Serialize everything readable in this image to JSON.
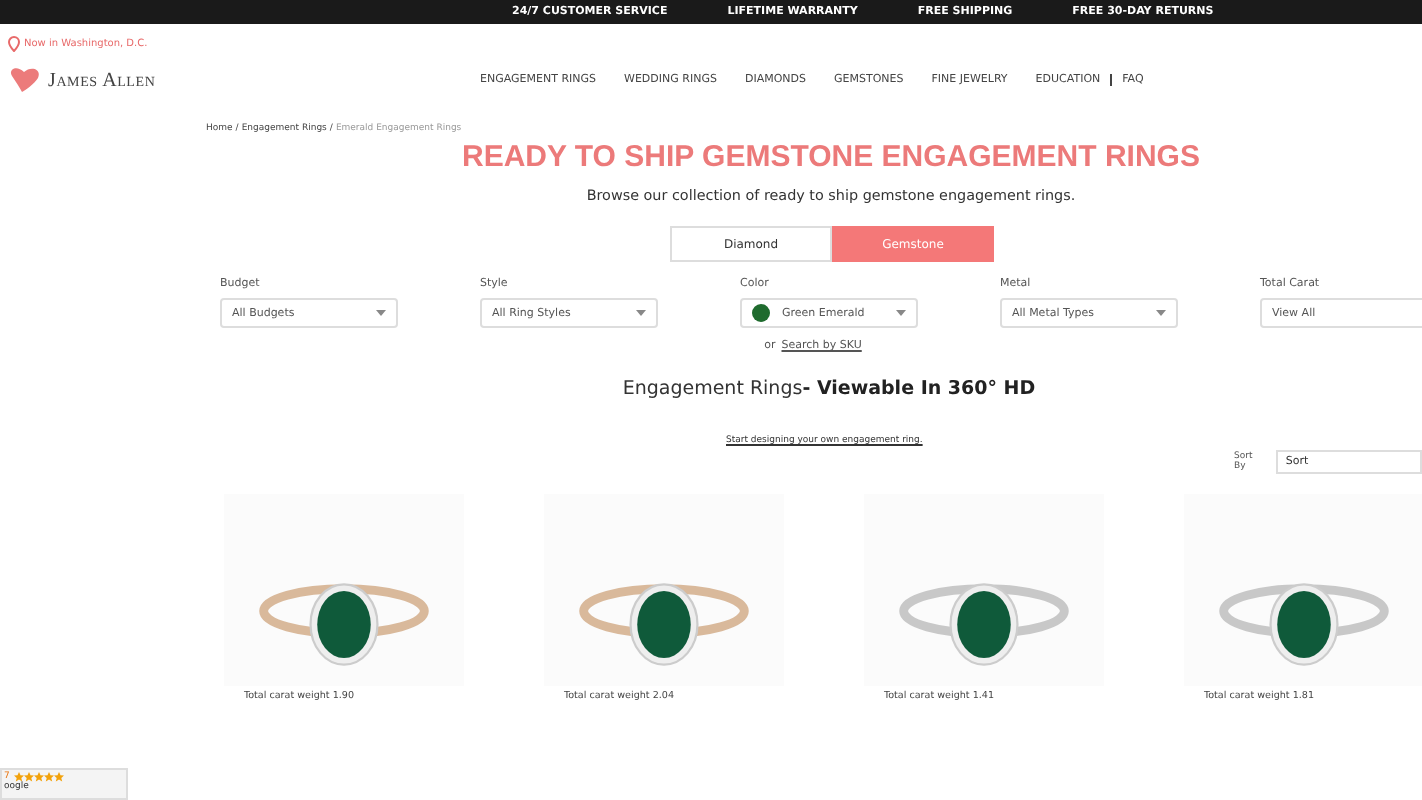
{
  "top_bar": {
    "items": [
      "24/7 CUSTOMER SERVICE",
      "LIFETIME WARRANTY",
      "FREE SHIPPING",
      "FREE 30-DAY RETURNS"
    ]
  },
  "location": "Now in Washington, D.C.",
  "logo": "James Allen",
  "nav": {
    "items": [
      "ENGAGEMENT RINGS",
      "WEDDING RINGS",
      "DIAMONDS",
      "GEMSTONES",
      "FINE JEWELRY",
      "EDUCATION",
      "FAQ"
    ]
  },
  "breadcrumb": [
    {
      "kind": "link",
      "label": "Home"
    },
    {
      "kind": "separator",
      "label": "/"
    },
    {
      "kind": "link",
      "label": "Engagement Rings"
    },
    {
      "kind": "separator",
      "label": "/"
    },
    {
      "kind": "current",
      "label": "Emerald Engagement Rings"
    }
  ],
  "title": "READY TO SHIP GEMSTONE ENGAGEMENT RINGS",
  "subtitle": "Browse our collection of ready to ship gemstone engagement rings.",
  "toggle": [
    {
      "label": "Diamond",
      "selected": false
    },
    {
      "label": "Gemstone",
      "selected": true
    }
  ],
  "filters": [
    {
      "label": "Budget",
      "value": "All Budgets"
    },
    {
      "label": "Style",
      "value": "All Ring Styles"
    },
    {
      "label": "Color",
      "value": "Green Emerald",
      "color": "#1f6b2e"
    },
    {
      "label": "Metal",
      "value": "All Metal Types"
    },
    {
      "label": "Total Carat",
      "value": "View All"
    }
  ],
  "sku": {
    "prefix": "or",
    "link": "Search by SKU"
  },
  "section_heading": "Engagement Rings**- Viewable In 360° HD**",
  "design_link": "Start designing your own engagement ring.",
  "sort": {
    "label": "Sort By",
    "value": "Sort"
  },
  "products": [
    {
      "caption": "Total carat weight 1.90",
      "kind": "rose"
    },
    {
      "caption": "Total carat weight 2.04",
      "kind": "rose"
    },
    {
      "caption": "Total carat weight 1.41",
      "kind": "white"
    },
    {
      "caption": "Total carat weight 1.81",
      "kind": "white"
    }
  ],
  "review_badge": {
    "rating": "7",
    "stars": 5,
    "source": "oogle"
  }
}
